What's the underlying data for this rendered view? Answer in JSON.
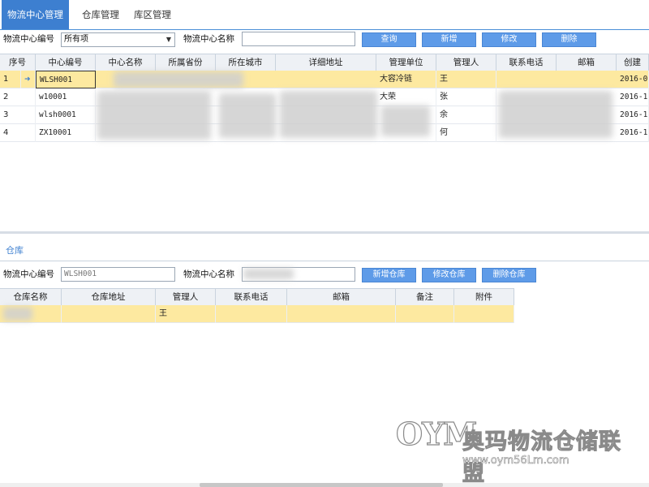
{
  "tabs": [
    {
      "label": "物流中心管理",
      "active": true
    },
    {
      "label": "仓库管理",
      "active": false
    },
    {
      "label": "库区管理",
      "active": false
    }
  ],
  "top_toolbar": {
    "code_label": "物流中心编号",
    "code_select_value": "所有项",
    "name_label": "物流中心名称",
    "name_input_value": "",
    "buttons": [
      "查询",
      "新增",
      "修改",
      "删除"
    ]
  },
  "center_table": {
    "columns": [
      "序号",
      "中心编号",
      "中心名称",
      "所属省份",
      "所在城市",
      "详细地址",
      "管理单位",
      "管理人",
      "联系电话",
      "邮箱",
      "创建"
    ],
    "rows": [
      {
        "index": "1",
        "code": "WLSH001",
        "unit": "大容冷链",
        "manager": "王",
        "date": "2016-0",
        "selected": true
      },
      {
        "index": "2",
        "code": "w10001",
        "unit": "大荣",
        "manager": "张",
        "date": "2016-1",
        "selected": false
      },
      {
        "index": "3",
        "code": "wlsh0001",
        "unit": "",
        "manager": "余",
        "date": "2016-1",
        "selected": false
      },
      {
        "index": "4",
        "code": "ZX10001",
        "unit": "",
        "manager": "何",
        "date": "2016-1",
        "selected": false
      }
    ]
  },
  "warehouse_tab": {
    "label": "仓库"
  },
  "bottom_toolbar": {
    "code_label": "物流中心编号",
    "code_input_value": "WLSH001",
    "name_label": "物流中心名称",
    "buttons": [
      "新增仓库",
      "修改仓库",
      "删除仓库"
    ]
  },
  "warehouse_table": {
    "columns": [
      "仓库名称",
      "仓库地址",
      "管理人",
      "联系电话",
      "邮箱",
      "备注",
      "附件"
    ],
    "rows": [
      {
        "name": "",
        "address": "",
        "manager": "王",
        "phone": "",
        "email": "",
        "note": "",
        "attachment": ""
      }
    ]
  },
  "watermark": {
    "logo": "OYM",
    "text": "奥玛物流仓储联盟",
    "url": "www.oym56Lm.com"
  },
  "colors": {
    "accent": "#3d7fd0",
    "button": "#5e9be8",
    "selected_row": "#fde9a0",
    "header_bg": "#eef1f5"
  }
}
